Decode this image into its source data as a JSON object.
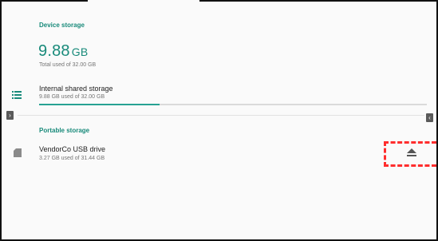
{
  "device_storage": {
    "header": "Device storage",
    "used_value": "9.88",
    "used_unit": "GB",
    "total_text": "Total used of 32.00 GB"
  },
  "internal": {
    "title": "Internal shared storage",
    "subtitle": "9.88 GB used of 32.00 GB",
    "usage_fraction": 0.31
  },
  "portable_storage": {
    "header": "Portable storage",
    "drive_title": "VendorCo USB drive",
    "drive_subtitle": "3.27 GB used of 31.44 GB"
  },
  "icons": {
    "list": "list-icon",
    "sd": "sd-card-icon",
    "eject": "eject-icon",
    "nav_left": "chevron-right-icon",
    "nav_right": "chevron-left-icon"
  },
  "colors": {
    "accent": "#188a7a",
    "bar": "#27a293",
    "highlight": "#ff2d2d"
  }
}
